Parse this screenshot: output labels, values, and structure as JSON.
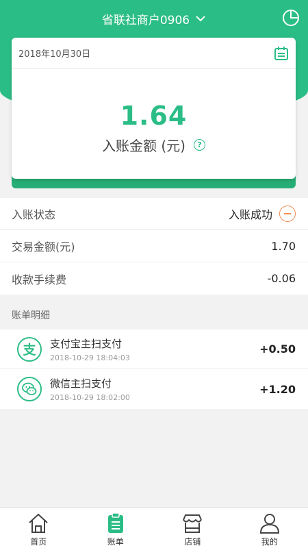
{
  "header": {
    "merchant_name": "省联社商户0906"
  },
  "card": {
    "date": "2018年10月30日",
    "amount": "1.64",
    "amount_label": "入账金额 (元)",
    "help_symbol": "?"
  },
  "info": [
    {
      "label": "入账状态",
      "value": "入账成功"
    },
    {
      "label": "交易金额(元)",
      "value": "1.70"
    },
    {
      "label": "收款手续费",
      "value": "-0.06"
    }
  ],
  "section_title": "账单明细",
  "bills": [
    {
      "name": "支付宝主扫支付",
      "time": "2018-10-29 18:04:03",
      "amount": "+0.50",
      "icon": "alipay-icon"
    },
    {
      "name": "微信主扫支付",
      "time": "2018-10-29 18:02:00",
      "amount": "+1.20",
      "icon": "wechat-icon"
    }
  ],
  "tabs": [
    {
      "label": "首页",
      "icon": "home-icon"
    },
    {
      "label": "账单",
      "icon": "bill-icon",
      "active": true
    },
    {
      "label": "店铺",
      "icon": "shop-icon"
    },
    {
      "label": "我的",
      "icon": "user-icon"
    }
  ],
  "colors": {
    "brand": "#2bbd86",
    "accent_orange": "#f08c55",
    "background": "#f2f2f2"
  }
}
